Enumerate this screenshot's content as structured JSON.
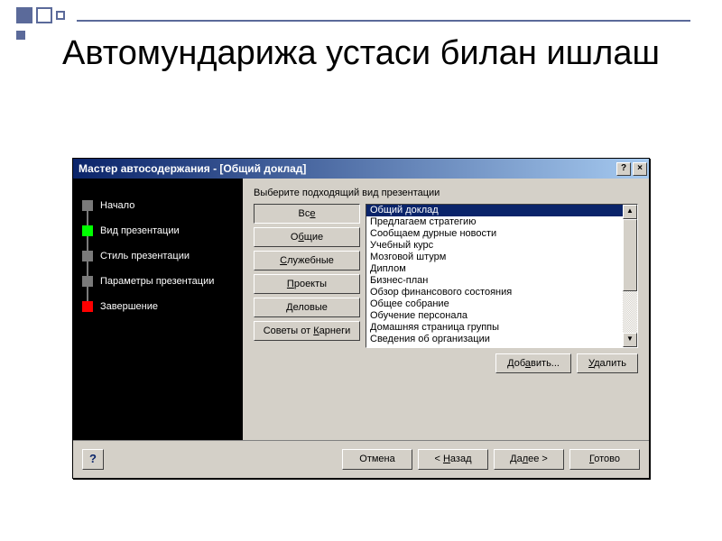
{
  "slide": {
    "title": "Автомундарижа устаси билан ишлаш"
  },
  "dialog": {
    "title": "Мастер автосодержания - [Общий доклад]",
    "help_glyph": "?",
    "close_glyph": "×",
    "steps": [
      {
        "label": "Начало"
      },
      {
        "label": "Вид презентации"
      },
      {
        "label": "Стиль презентации"
      },
      {
        "label": "Параметры презентации"
      },
      {
        "label": "Завершение"
      }
    ],
    "prompt": "Выберите подходящий вид презентации",
    "categories": {
      "all": "Все",
      "common": "Общие",
      "service": "Служебные",
      "projects": "Проекты",
      "business": "Деловые",
      "carnegie": "Советы от Карнеги"
    },
    "list": [
      "Общий доклад",
      "Предлагаем стратегию",
      "Сообщаем дурные новости",
      "Учебный курс",
      "Мозговой штурм",
      "Диплом",
      "Бизнес-план",
      "Обзор финансового состояния",
      "Общее собрание",
      "Обучение персонала",
      "Домашняя страница группы",
      "Сведения об организации"
    ],
    "add_btn": "Добавить...",
    "remove_btn": "Удалить",
    "scroll_up": "▲",
    "scroll_down": "▼",
    "footer": {
      "help": "?",
      "cancel": "Отмена",
      "back": "< Назад",
      "next": "Далее >",
      "finish": "Готово"
    }
  }
}
